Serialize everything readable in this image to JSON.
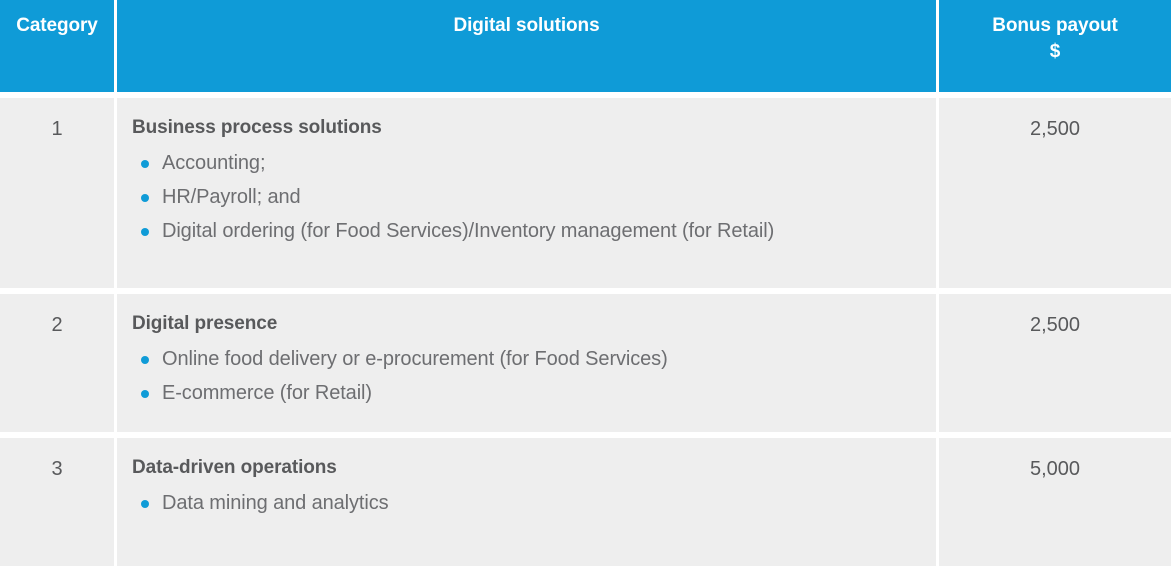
{
  "colors": {
    "header_blue": "#0f9bd7",
    "row_background": "#eeeeee",
    "page_background": "#ffffff",
    "title_text": "#58595b",
    "body_text": "#6d6e71",
    "bullet_blue": "#0f9bd7",
    "divider": "#ffffff"
  },
  "table": {
    "headers": {
      "category": "Category",
      "solutions": "Digital solutions",
      "bonus_line1": "Bonus payout",
      "bonus_line2": "$"
    },
    "rows": [
      {
        "category": "1",
        "title": "Business process solutions",
        "bullets": [
          "Accounting;",
          "HR/Payroll; and",
          "Digital ordering (for Food Services)/Inventory management (for Retail)"
        ],
        "bonus": "2,500"
      },
      {
        "category": "2",
        "title": "Digital presence",
        "bullets": [
          "Online food delivery or e-procurement (for Food Services)",
          "E-commerce (for Retail)"
        ],
        "bonus": "2,500"
      },
      {
        "category": "3",
        "title": "Data-driven operations",
        "bullets": [
          "Data mining and analytics"
        ],
        "bonus": "5,000"
      }
    ]
  }
}
